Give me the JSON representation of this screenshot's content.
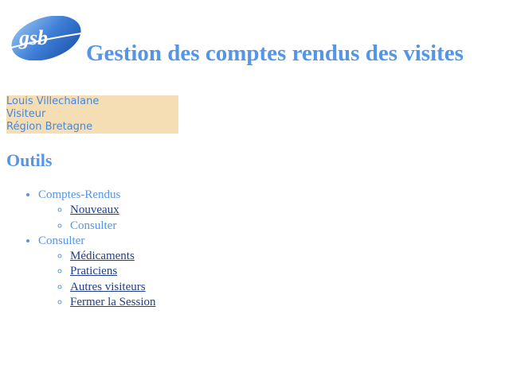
{
  "header": {
    "logo_text": "gsb",
    "title": "Gestion des comptes rendus des visites"
  },
  "user": {
    "name": "Louis Villechalane",
    "role": "Visiteur",
    "region": "Région Bretagne"
  },
  "tools": {
    "title": "Outils",
    "groups": [
      {
        "label": "Comptes-Rendus",
        "items": [
          {
            "label": "Nouveaux"
          },
          {
            "label": "Consulter"
          }
        ]
      },
      {
        "label": "Consulter",
        "items": [
          {
            "label": "Médicaments"
          },
          {
            "label": "Praticiens"
          },
          {
            "label": "Autres visiteurs"
          },
          {
            "label": "Fermer la Session"
          }
        ]
      }
    ]
  },
  "colors": {
    "accent": "#5495e8",
    "link": "#1f3d8a",
    "user_box_bg": "#f5deb3"
  }
}
